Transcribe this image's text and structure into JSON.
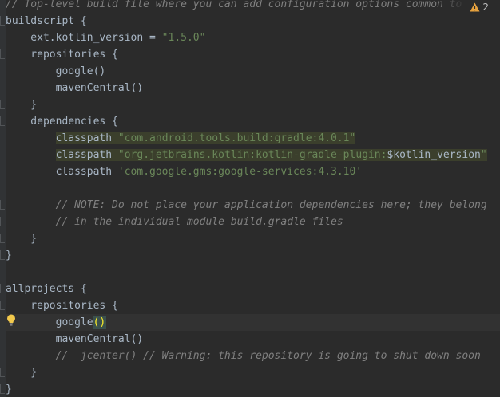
{
  "status": {
    "warning_count": "2"
  },
  "colors": {
    "background": "#2b2b2b",
    "text": "#a9b7c6",
    "string": "#6a8759",
    "comment": "#808080",
    "warning": "#e8a33e",
    "usage_highlight": "#3b3f2c"
  },
  "code": {
    "l1": "// Top-level build file where you can add configuration options common to all sub-projects/modules.",
    "l2": "buildscript {",
    "l3a": "    ext.kotlin_version = ",
    "l3b": "\"1.5.0\"",
    "l4": "    repositories {",
    "l5": "        google()",
    "l6": "        mavenCentral()",
    "l7": "    }",
    "l8": "    dependencies {",
    "l9a": "classpath",
    "l9b": "\"com.android.tools.build:gradle:4.0.1\"",
    "l10a": "classpath",
    "l10b": "\"org.jetbrains.kotlin:kotlin-gradle-plugin:",
    "l10c": "$kotlin_version",
    "l10d": "\"",
    "l11a": "        classpath ",
    "l11b": "'com.google.gms:google-services:4.3.10'",
    "l12": "",
    "l13": "        // NOTE: Do not place your application dependencies here; they belong",
    "l14": "        // in the individual module build.gradle files",
    "l15": "    }",
    "l16": "}",
    "l17": "",
    "l18": "allprojects {",
    "l19": "    repositories {",
    "l20a": "        google",
    "l20b": "()",
    "l21": "        mavenCentral()",
    "l22": "        //  jcenter() // Warning: this repository is going to shut down soon",
    "l23": "    }",
    "l24": "}"
  }
}
